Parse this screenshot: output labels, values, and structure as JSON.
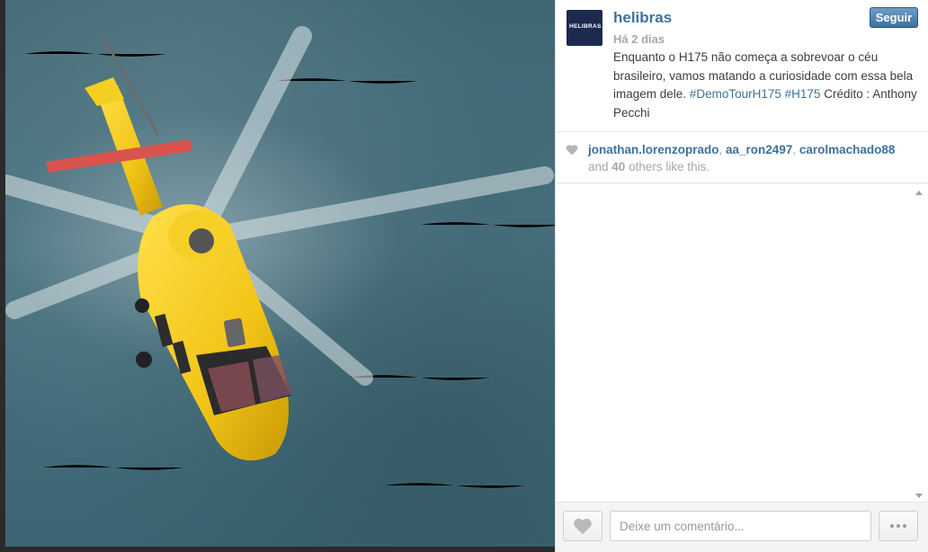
{
  "post": {
    "username": "helibras",
    "avatar_text": "HELIBRAS",
    "timestamp": "Há 2 dias",
    "follow_label": "Seguir",
    "caption_text": "Enquanto o H175 não começa a sobrevoar o céu brasileiro, vamos matando a curiosidade com essa bela imagem dele.",
    "hashtags": [
      "#DemoTourH175",
      "#H175"
    ],
    "caption_credit": "Crédito : Anthony Pecchi"
  },
  "likes": {
    "users": [
      "jonathan.lorenzoprado",
      "aa_ron2497",
      "carolmachado88"
    ],
    "separator": ", ",
    "prefix": "and",
    "count": "40",
    "suffix": "others like this."
  },
  "footer": {
    "comment_placeholder": "Deixe um comentário..."
  },
  "icons": {
    "heart": "heart-icon",
    "more": "more-dots-icon"
  },
  "colors": {
    "link": "#3f729b",
    "muted": "#a5a7aa",
    "follow_button": "#3f729b",
    "helicopter": "#f2c417",
    "sea": "#4b7482"
  }
}
